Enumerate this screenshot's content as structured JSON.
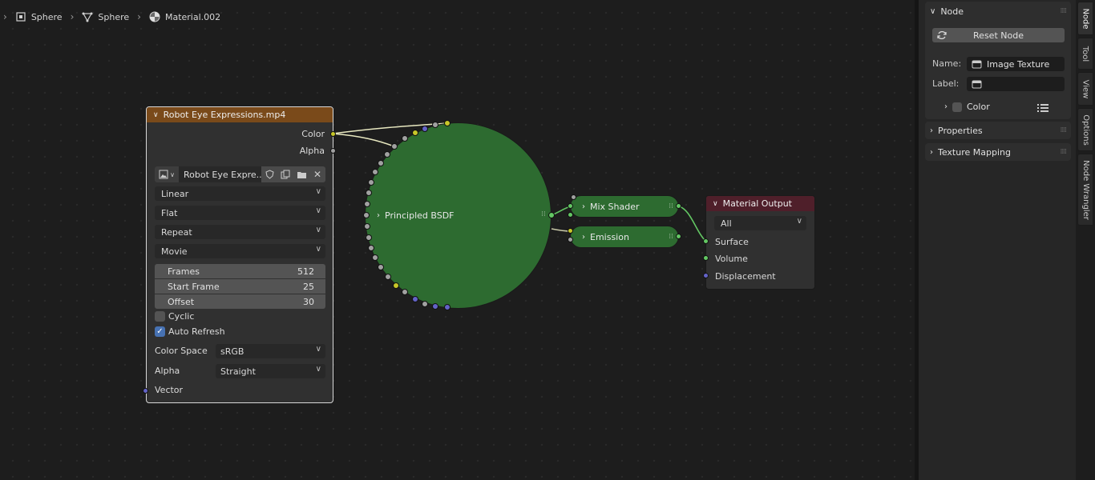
{
  "breadcrumb": {
    "items": [
      {
        "label": "Sphere",
        "icon": "object-icon"
      },
      {
        "label": "Sphere",
        "icon": "mesh-data-icon"
      },
      {
        "label": "Material.002",
        "icon": "material-icon"
      }
    ]
  },
  "image_node": {
    "title": "Robot Eye Expressions.mp4",
    "outputs": [
      "Color",
      "Alpha"
    ],
    "image_name": "Robot Eye Expre...",
    "interpolation": "Linear",
    "projection": "Flat",
    "extension": "Repeat",
    "source": "Movie",
    "fields": [
      {
        "label": "Frames",
        "value": "512"
      },
      {
        "label": "Start Frame",
        "value": "25"
      },
      {
        "label": "Offset",
        "value": "30"
      }
    ],
    "cyclic_label": "Cyclic",
    "cyclic": false,
    "auto_refresh_label": "Auto Refresh",
    "auto_refresh": true,
    "color_space_label": "Color Space",
    "color_space": "sRGB",
    "alpha_label": "Alpha",
    "alpha_mode": "Straight",
    "vector_label": "Vector",
    "header_color": "#7a4a1a"
  },
  "bsdf_node": {
    "title": "Principled BSDF",
    "color": "#2d6b30"
  },
  "mix_shader_node": {
    "title": "Mix Shader"
  },
  "emission_node": {
    "title": "Emission"
  },
  "material_output_node": {
    "title": "Material Output",
    "target": "All",
    "inputs": [
      "Surface",
      "Volume",
      "Displacement"
    ],
    "header_color": "#4f1f2a"
  },
  "sidebar": {
    "node_panel": {
      "title": "Node",
      "reset_label": "Reset Node",
      "name_label": "Name:",
      "name_value": "Image Texture",
      "label_label": "Label:",
      "label_value": "",
      "color_label": "Color"
    },
    "properties_label": "Properties",
    "texture_mapping_label": "Texture Mapping",
    "tabs": [
      "Node",
      "Tool",
      "View",
      "Options",
      "Node Wrangler"
    ]
  }
}
